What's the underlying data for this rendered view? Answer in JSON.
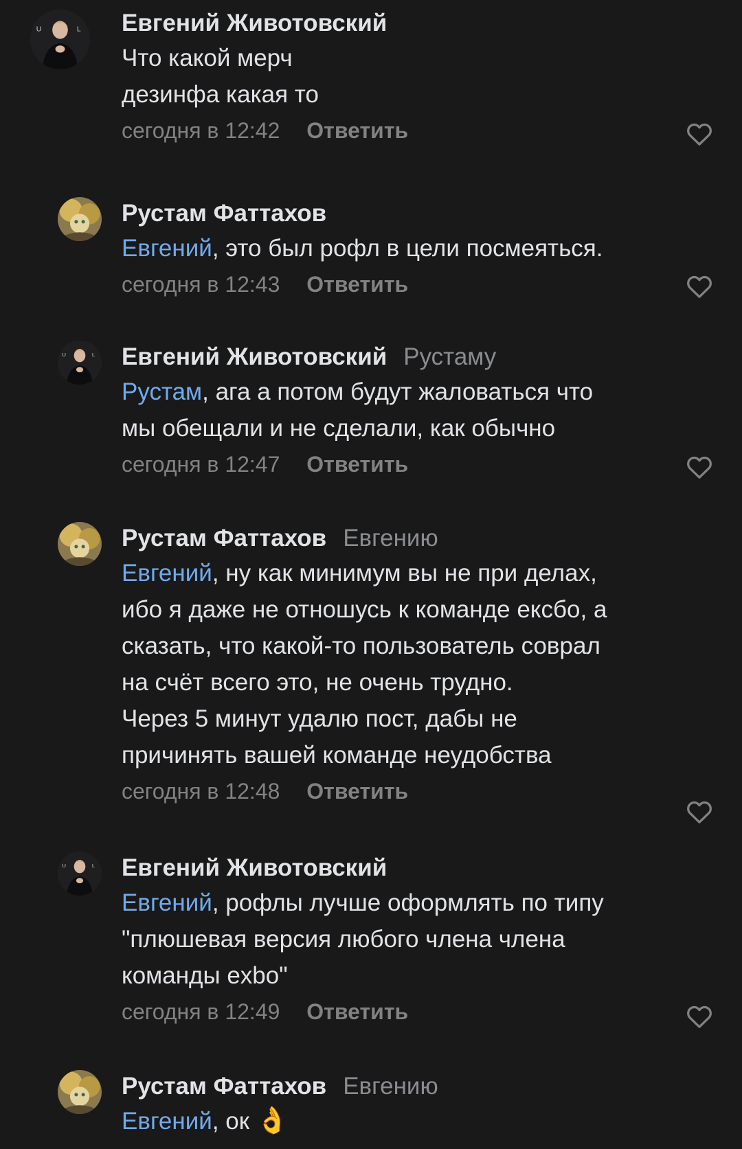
{
  "comments": [
    {
      "author": "Евгений Животовский",
      "reply_to": "",
      "mention": "",
      "text": "Что какой мерч\nдезинфа какая то",
      "time": "сегодня в 12:42",
      "reply_label": "Ответить",
      "avatar": "zhivotovsky-avatar"
    },
    {
      "author": "Рустам Фаттахов",
      "reply_to": "",
      "mention": "Евгений",
      "text": ", это был рофл в цели посмеяться.",
      "time": "сегодня в 12:43",
      "reply_label": "Ответить",
      "avatar": "fattakhov-avatar"
    },
    {
      "author": "Евгений Животовский",
      "reply_to": "Рустаму",
      "mention": "Рустам",
      "text": ", ага а потом будут жаловаться что\nмы обещали и не сделали, как обычно",
      "time": "сегодня в 12:47",
      "reply_label": "Ответить",
      "avatar": "zhivotovsky-avatar"
    },
    {
      "author": "Рустам Фаттахов",
      "reply_to": "Евгению",
      "mention": "Евгений",
      "text": ", ну как минимум вы не при делах,\nибо я даже не отношусь к команде ексбо, а\nсказать, что какой-то пользователь соврал\nна счёт всего это, не очень трудно.\nЧерез 5 минут удалю пост, дабы не\nпричинять вашей команде неудобства",
      "time": "сегодня в 12:48",
      "reply_label": "Ответить",
      "avatar": "fattakhov-avatar"
    },
    {
      "author": "Евгений Животовский",
      "reply_to": "",
      "mention": "Евгений",
      "text": ", рофлы лучше оформлять по типу\n\"плюшевая версия любого члена члена\nкоманды exbo\"",
      "time": "сегодня в 12:49",
      "reply_label": "Ответить",
      "avatar": "zhivotovsky-avatar"
    },
    {
      "author": "Рустам Фаттахов",
      "reply_to": "Евгению",
      "mention": "Евгений",
      "text": ", ок ",
      "emoji": "👌",
      "time": "",
      "reply_label": "",
      "avatar": "fattakhov-avatar"
    }
  ],
  "colors": {
    "background": "#19191a",
    "text": "#e1e3e6",
    "mention": "#71aaeb",
    "secondary": "#828282"
  },
  "icons": {
    "like": "heart-outline-icon"
  }
}
